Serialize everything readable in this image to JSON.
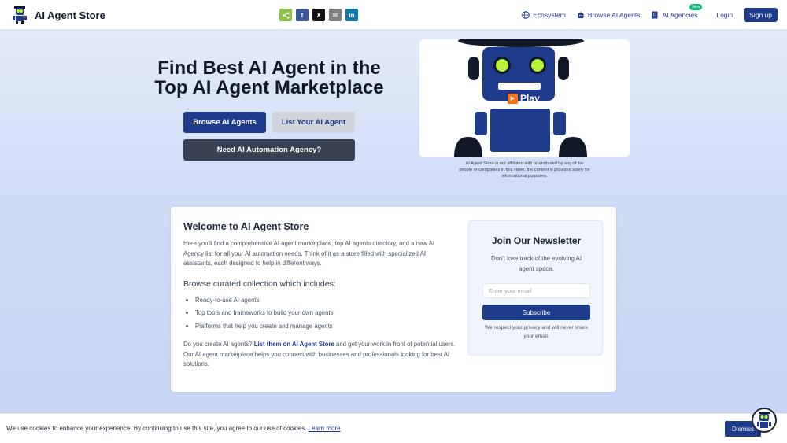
{
  "header": {
    "title": "AI Agent Store",
    "share": [
      {
        "id": "share",
        "glyph": "<",
        "color": "#8bc34a"
      },
      {
        "id": "facebook",
        "glyph": "f",
        "color": "#3b5998"
      },
      {
        "id": "x",
        "glyph": "X",
        "color": "#111111"
      },
      {
        "id": "email",
        "glyph": "✉",
        "color": "#7f7f7f"
      },
      {
        "id": "linkedin",
        "glyph": "in",
        "color": "#0e76a8"
      }
    ],
    "nav": {
      "ecosystem": "Ecosystem",
      "browse": "Browse AI Agents",
      "agencies": "AI Agencies",
      "agencies_badge": "New",
      "login": "Login",
      "signup": "Sign up"
    }
  },
  "hero": {
    "title_line1": "Find Best AI Agent in the",
    "title_line2": "Top AI Agent Marketplace",
    "browse_button": "Browse AI Agents",
    "list_button": "List Your AI Agent",
    "agency_button": "Need AI Automation Agency?"
  },
  "video": {
    "play_label": "Play",
    "disclaimer": "AI Agent Store is not affiliated with or endorsed by any of the people or companies in this video; the content is provided solely for informational purposes."
  },
  "welcome": {
    "title": "Welcome to AI Agent Store",
    "intro": "Here you'll find a comprehensive AI agent marketplace, top AI agents directory, and a new AI Agency list for all your AI automation needs. Think of it as a store filled with specialized AI assistants, each designed to help in different ways.",
    "collection_heading": "Browse curated collection which includes:",
    "collection_items": [
      "Ready-to-use AI agents",
      "Top tools and frameworks to build your own agents",
      "Platforms that help you create and manage agents"
    ],
    "outro_prefix": "Do you create AI agents? ",
    "outro_link": "List them on AI Agent Store",
    "outro_suffix": " and get your work in front of potential users. Our AI agent marketplace helps you connect with businesses and professionals looking for best AI solutions."
  },
  "newsletter": {
    "title": "Join Our Newsletter",
    "text": "Don't lose track of the evolving AI agent space.",
    "placeholder": "Enter your email",
    "value": "",
    "subscribe": "Subscribe",
    "privacy": "We respect your privacy and will never share your email."
  },
  "cookie": {
    "text": "We use cookies to enhance your experience. By continuing to use this site, you agree to our use of cookies. ",
    "link": "Learn more",
    "dismiss": "Dismiss"
  },
  "colors": {
    "brand": "#1e3a8a",
    "dark_button": "#374151",
    "light_button": "#d1d5db",
    "new_badge": "#10b981",
    "robot_eye": "#b6f23a"
  }
}
